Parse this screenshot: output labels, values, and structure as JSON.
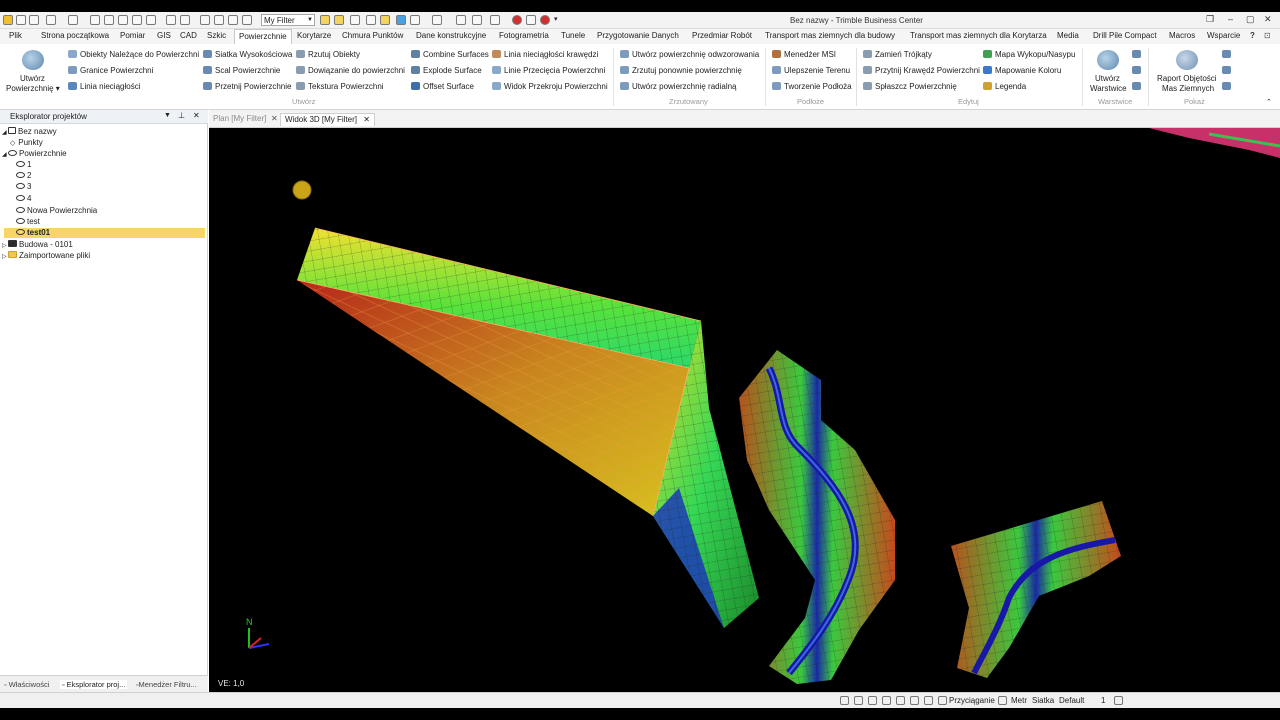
{
  "app": {
    "title": "Bez nazwy - Trimble Business Center",
    "filter_value": "My Filter"
  },
  "colors": {
    "accent": "#f7d56a",
    "viewport": "#000000"
  },
  "menu": {
    "tabs": [
      "Plik",
      "Strona początkowa",
      "Pomiar",
      "GIS",
      "CAD",
      "Szkic",
      "Powierzchnie",
      "Korytarze",
      "Chmura Punktów",
      "Dane konstrukcyjne",
      "Fotogrametria",
      "Tunele",
      "Przygotowanie Danych",
      "Przedmiar Robót",
      "Transport mas ziemnych dla budowy",
      "Transport mas ziemnych dla Korytarza",
      "Media",
      "Drill Pile Compact",
      "Macros",
      "Wsparcie"
    ],
    "active": "Powierzchnie"
  },
  "ribbon": {
    "big_create_line1": "Utwórz",
    "big_create_line2": "Powierzchnię",
    "utworz": {
      "col1": [
        "Obiekty Należące do Powierzchni",
        "Granice Powierzchni",
        "Linia nieciągłości"
      ],
      "col2": [
        "Siatka Wysokościowa",
        "Scal Powierzchnie",
        "Przetnij Powierzchnie"
      ],
      "col3": [
        "Rzutuj Obiekty",
        "Dowiązanie do powierzchni",
        "Tekstura Powierzchni"
      ],
      "col4": [
        "Combine Surfaces",
        "Explode Surface",
        "Offset Surface"
      ],
      "col5": [
        "Linia nieciągłości krawędzi",
        "Linie Przecięcia Powierzchni",
        "Widok Przekroju Powierzchni"
      ],
      "label": "Utwórz"
    },
    "zrzutowany": {
      "items": [
        "Utwórz powierzchnię odwzorowania",
        "Zrzutuj ponownie powierzchnię",
        "Utwórz powierzchnię radialną"
      ],
      "label": "Zrzutowany"
    },
    "podloze": {
      "items": [
        "Menedżer MSI",
        "Ulepszenie Terenu",
        "Tworzenie Podłoża"
      ],
      "label": "Podłoże"
    },
    "edytuj": {
      "col1": [
        "Zamień Trójkąty",
        "Przytnij Krawędź Powierzchni",
        "Spłaszcz Powierzchnię"
      ],
      "col2": [
        "Mapa Wykopu/Nasypu",
        "Mapowanie Koloru",
        "Legenda"
      ],
      "label": "Edytuj"
    },
    "warstwice": {
      "line1": "Utwórz",
      "line2": "Warstwice",
      "label": "Warstwice"
    },
    "pokaz": {
      "line1": "Raport Objętości",
      "line2": "Mas Ziemnych",
      "label": "Pokaż"
    }
  },
  "explorer": {
    "title": "Eksplorator projektów",
    "tree": [
      {
        "label": "Bez nazwy",
        "level": 0
      },
      {
        "label": "Punkty",
        "level": 1
      },
      {
        "label": "Powierzchnie",
        "level": 0
      },
      {
        "label": "1",
        "level": 2
      },
      {
        "label": "2",
        "level": 2
      },
      {
        "label": "3",
        "level": 2
      },
      {
        "label": "4",
        "level": 2
      },
      {
        "label": "Nowa Powierzchnia",
        "level": 2
      },
      {
        "label": "test",
        "level": 2
      },
      {
        "label": "test01",
        "level": 2
      },
      {
        "label": "Budowa - 0101",
        "level": 0
      },
      {
        "label": "Zaimportowane pliki",
        "level": 0
      }
    ],
    "selected": "test01",
    "bottom_tabs": [
      "Właściwości",
      "Eksplorator proj...",
      "Menedżer Filtru..."
    ]
  },
  "document_tabs": [
    {
      "label": "Plan [My Filter]",
      "active": false
    },
    {
      "label": "Widok 3D [My Filter]",
      "active": true
    }
  ],
  "viewport": {
    "ve_label": "VE: 1,0",
    "north_label": "N"
  },
  "status": {
    "snap": "Przyciąganie",
    "unit": "Metr",
    "grid": "Siatka",
    "layer": "Default",
    "count": "1"
  }
}
